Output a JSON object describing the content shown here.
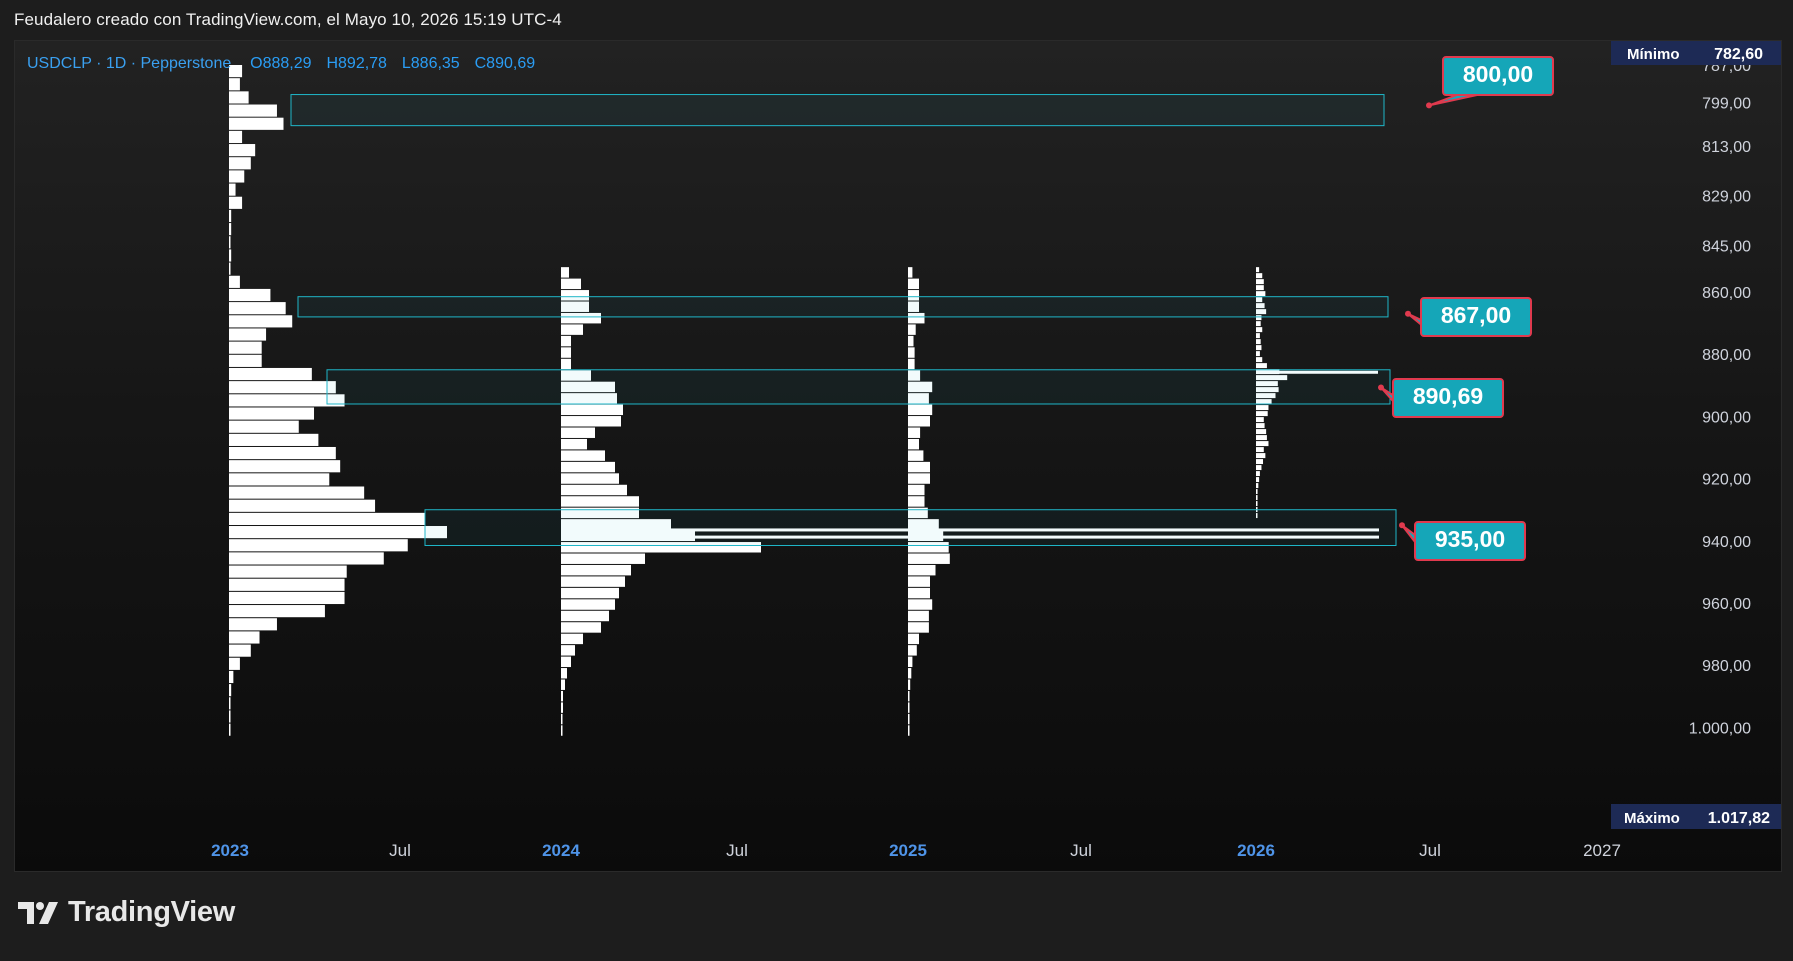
{
  "header": {
    "caption": "Feudalero creado con TradingView.com, el Mayo 10, 2026 15:19 UTC-4"
  },
  "legend": {
    "symbol": "USDCLP · 1D · Pepperstone",
    "o_label": "O",
    "o_value": "888,29",
    "h_label": "H",
    "h_value": "892,78",
    "l_label": "L",
    "l_value": "886,35",
    "c_label": "C",
    "c_value": "890,69"
  },
  "colors": {
    "accent": "#2962ff",
    "axis_text": "#4f94e8",
    "zone_border": "#1fb6c8",
    "callout_fill": "#15a6b8",
    "callout_border": "#e03a4e",
    "profile_bar": "#ffffff",
    "badge_bg": "#1d2a55"
  },
  "footer": {
    "brand": "TradingView"
  },
  "chart_data": {
    "type": "volume-profile",
    "symbol": "USDCLP",
    "timeframe": "1D",
    "y_axis": {
      "inverted": true,
      "range": [
        782.6,
        1017.82
      ],
      "ticks": [
        787,
        799,
        813,
        829,
        845,
        860,
        880,
        900,
        920,
        940,
        960,
        980,
        1000
      ],
      "tick_labels": [
        "787,00",
        "799,00",
        "813,00",
        "829,00",
        "845,00",
        "860,00",
        "880,00",
        "900,00",
        "920,00",
        "940,00",
        "960,00",
        "980,00",
        "1.000,00"
      ]
    },
    "x_axis": {
      "labels": [
        "2023",
        "Jul",
        "2024",
        "Jul",
        "2025",
        "Jul",
        "2026",
        "Jul",
        "2027"
      ],
      "bold_labels": [
        "2023",
        "2024",
        "2025",
        "2026"
      ]
    },
    "min_badge": {
      "label": "Mínimo",
      "value": "782,60"
    },
    "max_badge": {
      "label": "Máximo",
      "value": "1.017,82"
    },
    "profiles": [
      {
        "period": "2023",
        "price_low": 787,
        "price_high": 1003,
        "bar_values": [
          0.06,
          0.05,
          0.09,
          0.22,
          0.25,
          0.06,
          0.12,
          0.1,
          0.07,
          0.03,
          0.06,
          0.01,
          0.01,
          0.0,
          0.01,
          0.0,
          0.05,
          0.19,
          0.26,
          0.29,
          0.17,
          0.15,
          0.15,
          0.38,
          0.49,
          0.53,
          0.39,
          0.32,
          0.41,
          0.49,
          0.51,
          0.46,
          0.62,
          0.67,
          0.9,
          1.0,
          0.82,
          0.71,
          0.54,
          0.53,
          0.53,
          0.44,
          0.22,
          0.14,
          0.1,
          0.05,
          0.02,
          0.01,
          0.0,
          0.0,
          0.0
        ]
      },
      {
        "period": "2024",
        "price_low": 852,
        "price_high": 1003,
        "bar_values": [
          0.04,
          0.1,
          0.14,
          0.14,
          0.2,
          0.11,
          0.05,
          0.05,
          0.05,
          0.15,
          0.27,
          0.28,
          0.31,
          0.3,
          0.17,
          0.13,
          0.22,
          0.27,
          0.29,
          0.33,
          0.39,
          0.39,
          0.55,
          0.67,
          1.0,
          0.42,
          0.35,
          0.32,
          0.29,
          0.27,
          0.24,
          0.2,
          0.11,
          0.07,
          0.05,
          0.03,
          0.02,
          0.01,
          0.01,
          0.0,
          0.0
        ]
      },
      {
        "period": "2025",
        "price_low": 852,
        "price_high": 1003,
        "bar_values": [
          0.04,
          0.1,
          0.1,
          0.1,
          0.15,
          0.07,
          0.05,
          0.06,
          0.06,
          0.11,
          0.22,
          0.19,
          0.22,
          0.2,
          0.11,
          0.1,
          0.14,
          0.2,
          0.2,
          0.15,
          0.15,
          0.18,
          0.28,
          0.32,
          0.37,
          0.38,
          0.25,
          0.2,
          0.2,
          0.22,
          0.19,
          0.19,
          0.1,
          0.08,
          0.04,
          0.03,
          0.02,
          0.01,
          0.01,
          0.0,
          0.0
        ]
      },
      {
        "period": "2026",
        "price_low": 852,
        "price_high": 933,
        "bar_values": [
          0.04,
          0.08,
          0.1,
          0.1,
          0.12,
          0.08,
          0.11,
          0.13,
          0.07,
          0.06,
          0.08,
          0.05,
          0.06,
          0.07,
          0.05,
          0.08,
          0.14,
          0.3,
          0.4,
          0.28,
          0.29,
          0.25,
          0.2,
          0.16,
          0.15,
          0.1,
          0.11,
          0.13,
          0.14,
          0.16,
          0.1,
          0.12,
          0.09,
          0.07,
          0.05,
          0.04,
          0.03,
          0.02,
          0.02,
          0.01,
          0.01,
          0.01
        ]
      }
    ],
    "zones": [
      {
        "price_top": 796.5,
        "price_bottom": 806.5
      },
      {
        "price_top": 861.5,
        "price_bottom": 868
      },
      {
        "price_top": 885,
        "price_bottom": 896
      },
      {
        "price_top": 930,
        "price_bottom": 941.5
      }
    ],
    "extended_bars": [
      {
        "period": "2024-2025",
        "price": 936.5
      },
      {
        "period": "2024-2025",
        "price": 938.8
      },
      {
        "period": "2026",
        "price": 885.8
      }
    ],
    "callouts": [
      {
        "label": "800,00",
        "price": 800
      },
      {
        "label": "867,00",
        "price": 867
      },
      {
        "label": "890,69",
        "price": 890.69
      },
      {
        "label": "935,00",
        "price": 935
      }
    ]
  }
}
